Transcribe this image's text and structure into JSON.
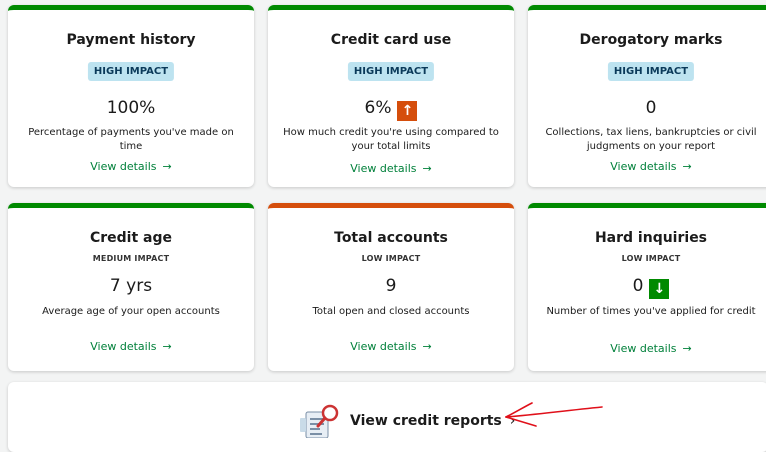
{
  "cards": [
    {
      "title": "Payment history",
      "impact": "HIGH IMPACT",
      "value": "100%",
      "desc": "Percentage of payments you've made on time",
      "link": "View details"
    },
    {
      "title": "Credit card use",
      "impact": "HIGH IMPACT",
      "value": "6%",
      "desc": "How much credit you're using compared to your total limits",
      "link": "View details"
    },
    {
      "title": "Derogatory marks",
      "impact": "HIGH IMPACT",
      "value": "0",
      "desc": "Collections, tax liens, bankruptcies or civil judgments on your report",
      "link": "View details"
    },
    {
      "title": "Credit age",
      "impact": "MEDIUM IMPACT",
      "value": "7 yrs",
      "desc": "Average age of your open accounts",
      "link": "View details"
    },
    {
      "title": "Total accounts",
      "impact": "LOW IMPACT",
      "value": "9",
      "desc": "Total open and closed accounts",
      "link": "View details"
    },
    {
      "title": "Hard inquiries",
      "impact": "LOW IMPACT",
      "value": "0",
      "desc": "Number of times you've applied for credit",
      "link": "View details"
    }
  ],
  "icons": {
    "link_arrow": "→",
    "trend_up": "↑",
    "trend_down": "↓",
    "reports_chevron": "›"
  },
  "footer": {
    "label": "View credit reports"
  },
  "colors": {
    "green": "#008a00",
    "orange": "#d54e0c",
    "badge_bg": "#bde3f0",
    "link": "#00803a",
    "annotation": "#e0101a"
  }
}
